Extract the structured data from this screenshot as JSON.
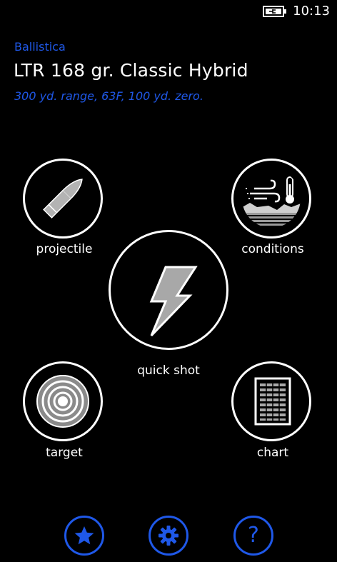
{
  "status_bar": {
    "time": "10:13",
    "battery_icon": "battery-charging-icon"
  },
  "header": {
    "app_name": "Ballistica",
    "title": "LTR 168 gr. Classic Hybrid",
    "subtitle": "300 yd. range, 63F, 100 yd. zero."
  },
  "tiles": {
    "projectile": {
      "label": "projectile",
      "icon": "bullet-icon"
    },
    "conditions": {
      "label": "conditions",
      "icon": "weather-conditions-icon"
    },
    "quick_shot": {
      "label": "quick shot",
      "icon": "lightning-bolt-icon"
    },
    "target": {
      "label": "target",
      "icon": "target-icon"
    },
    "chart": {
      "label": "chart",
      "icon": "chart-table-icon"
    }
  },
  "appbar": {
    "buttons": [
      {
        "icon": "star-icon"
      },
      {
        "icon": "gear-icon"
      },
      {
        "icon": "help-icon",
        "glyph": "?"
      }
    ]
  },
  "colors": {
    "accent": "#1f58e8",
    "background": "#000000",
    "foreground": "#ffffff",
    "icon_gray": "#a8a8a8"
  }
}
